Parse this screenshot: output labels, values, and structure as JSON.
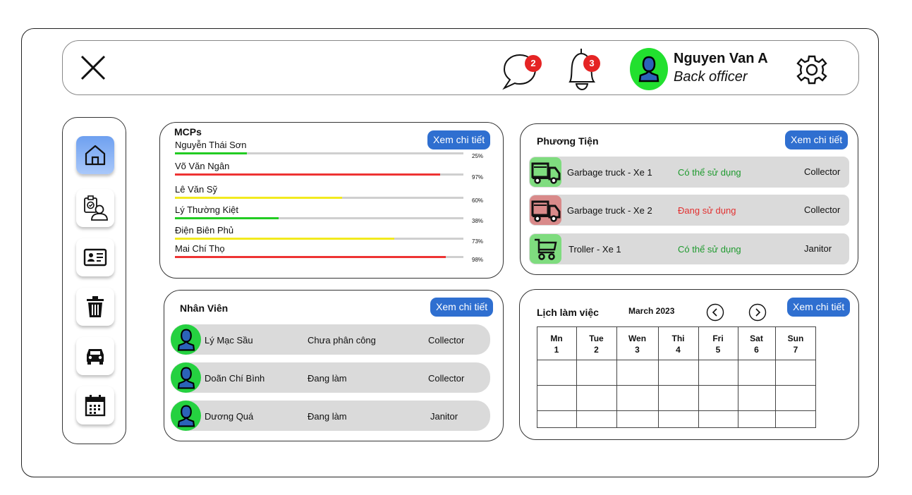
{
  "header": {
    "user_name": "Nguyen Van A",
    "user_role": "Back officer",
    "messages_count": "2",
    "notifications_count": "3"
  },
  "sidebar": {
    "items": [
      "home",
      "task-assign",
      "employee-card",
      "trash",
      "vehicle",
      "calendar"
    ],
    "active": "home"
  },
  "mcps": {
    "title": "MCPs",
    "detail_label": "Xem chi tiết",
    "items": [
      {
        "name": "Nguyễn Thái Sơn",
        "percent": "25%",
        "value": 0.25,
        "color": "#22cc22"
      },
      {
        "name": "Võ Văn Ngân",
        "percent": "97%",
        "value": 0.92,
        "color": "#ee3333"
      },
      {
        "name": "Lê Văn Sỹ",
        "percent": "60%",
        "value": 0.58,
        "color": "#f2ea1e"
      },
      {
        "name": "Lý Thường Kiệt",
        "percent": "38%",
        "value": 0.36,
        "color": "#22cc22"
      },
      {
        "name": "Điện Biên Phủ",
        "percent": "73%",
        "value": 0.76,
        "color": "#f2ea1e"
      },
      {
        "name": "Mai Chí Thọ",
        "percent": "98%",
        "value": 0.94,
        "color": "#ee3333"
      }
    ]
  },
  "vehicles": {
    "title": "Phương Tiện",
    "detail_label": "Xem chi tiết",
    "items": [
      {
        "name": "Garbage truck - Xe 1",
        "status": "Có thể sử dụng",
        "role": "Collector",
        "status_color": "#1e9a2e",
        "icon": "truck-icon",
        "icon_bg": "#7fdc7f"
      },
      {
        "name": "Garbage truck - Xe 2",
        "status": "Đang sử dụng",
        "role": "Collector",
        "status_color": "#e23030",
        "icon": "truck-icon",
        "icon_bg": "#d98a8a"
      },
      {
        "name": "Troller - Xe 1",
        "status": "Có thể sử dụng",
        "role": "Janitor",
        "status_color": "#1e9a2e",
        "icon": "cart-icon",
        "icon_bg": "#7fdc7f"
      }
    ]
  },
  "employees": {
    "title": "Nhân Viên",
    "detail_label": "Xem chi tiết",
    "items": [
      {
        "name": "Lý Mạc Sầu",
        "status": "Chưa phân công",
        "role": "Collector"
      },
      {
        "name": "Doãn Chí Bình",
        "status": "Đang làm",
        "role": "Collector"
      },
      {
        "name": "Dương Quá",
        "status": "Đang làm",
        "role": "Janitor"
      }
    ]
  },
  "schedule": {
    "title": "Lịch làm việc",
    "month": "March 2023",
    "detail_label": "Xem chi tiết",
    "days": [
      {
        "name": "Mn",
        "num": "1"
      },
      {
        "name": "Tue",
        "num": "2"
      },
      {
        "name": "Wen",
        "num": "3"
      },
      {
        "name": "Thi",
        "num": "4"
      },
      {
        "name": "Fri",
        "num": "5"
      },
      {
        "name": "Sat",
        "num": "6"
      },
      {
        "name": "Sun",
        "num": "7"
      }
    ]
  }
}
